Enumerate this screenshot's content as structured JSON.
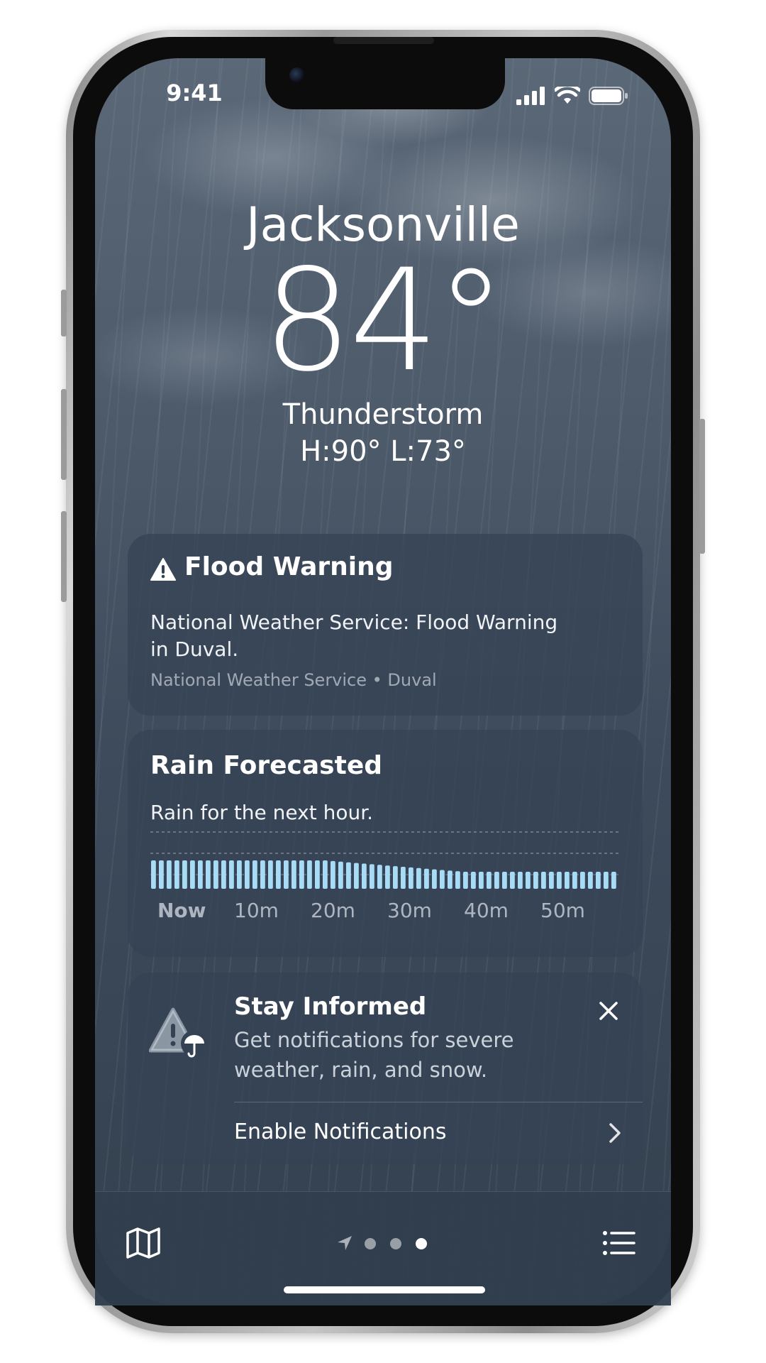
{
  "status_bar": {
    "time": "9:41"
  },
  "location": {
    "city": "Jacksonville",
    "temperature": "84°",
    "condition": "Thunderstorm",
    "high_low": "H:90°  L:73°"
  },
  "alert_card": {
    "title": "Flood Warning",
    "body_line1": "National Weather Service: Flood Warning",
    "body_line2": "in Duval.",
    "source": "National Weather Service • Duval"
  },
  "rain_card": {
    "title": "Rain Forecasted",
    "subtitle": "Rain for the next hour.",
    "axis_labels": [
      "Now",
      "10m",
      "20m",
      "30m",
      "40m",
      "50m"
    ],
    "bar_color": "#a8dcf6"
  },
  "notify_card": {
    "title": "Stay Informed",
    "body_line1": "Get notifications for severe",
    "body_line2": "weather, rain, and snow.",
    "action": "Enable Notifications"
  },
  "tab_bar": {
    "icons": [
      "map-icon",
      "location-arrow-icon",
      "page-dot-icon",
      "list-icon"
    ],
    "page_count": 3,
    "active_page": 3
  },
  "colors": {
    "card_background": "#344254",
    "accent_rain": "#a8dcf6",
    "text_primary": "#ffffff"
  }
}
